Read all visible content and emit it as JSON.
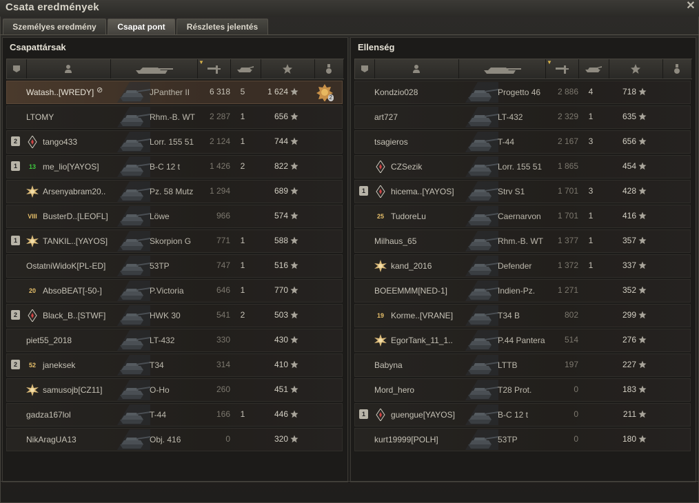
{
  "window": {
    "title": "Csata eredmények"
  },
  "tabs": [
    {
      "label": "Személyes eredmény"
    },
    {
      "label": "Csapat pont"
    },
    {
      "label": "Részletes jelentés"
    }
  ],
  "teams": {
    "allies": {
      "title": "Csapattársak",
      "rows": [
        {
          "name": "Watash..[WREDY]",
          "tank": "JPanther II",
          "damage": "6 318",
          "kills": "5",
          "xp": "1 624",
          "me": true,
          "medal_count": "2"
        },
        {
          "name": "LTOMY",
          "tank": "Rhm.-B. WT",
          "damage": "2 287",
          "kills": "1",
          "xp": "656"
        },
        {
          "platoon": "2",
          "name": "tango433",
          "tank": "Lorr. 155 51",
          "damage": "2 124",
          "kills": "1",
          "xp": "744",
          "rank": "diamond"
        },
        {
          "platoon": "1",
          "name": "me_lio[YAYOS]",
          "tank": "B-C 12 t",
          "damage": "1 426",
          "kills": "2",
          "xp": "822",
          "rank": "13",
          "rank_color": "#3fc83f"
        },
        {
          "name": "Arsenyabram20..",
          "tank": "Pz. 58 Mutz",
          "damage": "1 294",
          "kills": "",
          "xp": "689",
          "rank": "star"
        },
        {
          "name": "BusterD..[LEOFL]",
          "tank": "Löwe",
          "damage": "966",
          "kills": "",
          "xp": "574",
          "rank": "VIII"
        },
        {
          "platoon": "1",
          "name": "TANKIL..[YAYOS]",
          "tank": "Skorpion G",
          "damage": "771",
          "kills": "1",
          "xp": "588",
          "rank": "star"
        },
        {
          "name": "OstatniWidoK[PL-ED]",
          "tank": "53TP",
          "damage": "747",
          "kills": "1",
          "xp": "516"
        },
        {
          "name": "AbsoBEAT[-50-]",
          "tank": "P.Victoria",
          "damage": "646",
          "kills": "1",
          "xp": "770",
          "rank": "20"
        },
        {
          "platoon": "2",
          "name": "Black_B..[STWF]",
          "tank": "HWK 30",
          "damage": "541",
          "kills": "2",
          "xp": "503",
          "rank": "diamond"
        },
        {
          "name": "piet55_2018",
          "tank": "LT-432",
          "damage": "330",
          "kills": "",
          "xp": "430"
        },
        {
          "platoon": "2",
          "name": "janeksek",
          "tank": "T34",
          "damage": "314",
          "kills": "",
          "xp": "410",
          "rank": "52"
        },
        {
          "name": "samusojb[CZ11]",
          "tank": "O-Ho",
          "damage": "260",
          "kills": "",
          "xp": "451",
          "rank": "star"
        },
        {
          "name": "gadza167lol",
          "tank": "T-44",
          "damage": "166",
          "kills": "1",
          "xp": "446"
        },
        {
          "name": "NikAragUA13",
          "tank": "Obj. 416",
          "damage": "0",
          "kills": "",
          "xp": "320"
        }
      ]
    },
    "enemies": {
      "title": "Ellenség",
      "rows": [
        {
          "name": "Kondzio028",
          "tank": "Progetto 46",
          "damage": "2 886",
          "kills": "4",
          "xp": "718"
        },
        {
          "name": "art727",
          "tank": "LT-432",
          "damage": "2 329",
          "kills": "1",
          "xp": "635"
        },
        {
          "name": "tsagieros",
          "tank": "T-44",
          "damage": "2 167",
          "kills": "3",
          "xp": "656"
        },
        {
          "name": "CZSezik",
          "tank": "Lorr. 155 51",
          "damage": "1 865",
          "kills": "",
          "xp": "454",
          "rank": "diamond"
        },
        {
          "platoon": "1",
          "name": "hicema..[YAYOS]",
          "tank": "Strv S1",
          "damage": "1 701",
          "kills": "3",
          "xp": "428",
          "rank": "diamond"
        },
        {
          "name": "TudoreLu",
          "tank": "Caernarvon",
          "damage": "1 701",
          "kills": "1",
          "xp": "416",
          "rank": "25"
        },
        {
          "name": "Milhaus_65",
          "tank": "Rhm.-B. WT",
          "damage": "1 377",
          "kills": "1",
          "xp": "357"
        },
        {
          "name": "kand_2016",
          "tank": "Defender",
          "damage": "1 372",
          "kills": "1",
          "xp": "337",
          "rank": "star"
        },
        {
          "name": "BOEEMMM[NED-1]",
          "tank": "Indien-Pz.",
          "damage": "1 271",
          "kills": "",
          "xp": "352"
        },
        {
          "name": "Korme..[VRANE]",
          "tank": "T34 B",
          "damage": "802",
          "kills": "",
          "xp": "299",
          "rank": "19"
        },
        {
          "name": "EgorTank_11_1..",
          "tank": "P.44 Pantera",
          "damage": "514",
          "kills": "",
          "xp": "276",
          "rank": "star"
        },
        {
          "name": "Babyna",
          "tank": "LTTB",
          "damage": "197",
          "kills": "",
          "xp": "227"
        },
        {
          "name": "Mord_hero",
          "tank": "T28 Prot.",
          "damage": "0",
          "kills": "",
          "xp": "183"
        },
        {
          "platoon": "1",
          "name": "guengue[YAYOS]",
          "tank": "B-C 12 t",
          "damage": "0",
          "kills": "",
          "xp": "211",
          "rank": "diamond"
        },
        {
          "name": "kurt19999[POLH]",
          "tank": "53TP",
          "damage": "0",
          "kills": "",
          "xp": "180"
        }
      ]
    }
  },
  "colors": {
    "gold": "#d6b24a",
    "me_row": "#4a3a2c",
    "green_rank": "#3fc83f"
  }
}
